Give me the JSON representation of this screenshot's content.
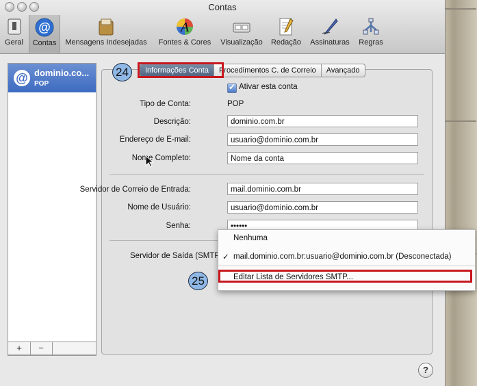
{
  "window": {
    "title": "Contas"
  },
  "toolbar": {
    "items": [
      {
        "label": "Geral",
        "icon": "switch-icon"
      },
      {
        "label": "Contas",
        "icon": "at-sign-icon"
      },
      {
        "label": "Mensagens Indesejadas",
        "icon": "junk-mail-icon"
      },
      {
        "label": "Fontes & Cores",
        "icon": "fonts-colors-icon"
      },
      {
        "label": "Visualização",
        "icon": "viewing-icon"
      },
      {
        "label": "Redação",
        "icon": "composing-icon"
      },
      {
        "label": "Assinaturas",
        "icon": "signature-pen-icon"
      },
      {
        "label": "Regras",
        "icon": "rules-icon"
      }
    ],
    "selected": "Contas"
  },
  "sidebar": {
    "account_name": "dominio.co...",
    "account_type": "POP",
    "add_label": "+",
    "remove_label": "−"
  },
  "tabs": {
    "info": "Informações Conta",
    "mailbox": "Procedimentos C. de Correio",
    "advanced": "Avançado",
    "selected": "Informações Conta"
  },
  "annotations": {
    "badge_24": "24",
    "badge_25": "25",
    "highlight_color": "#c8171d"
  },
  "form": {
    "enable_label": "Ativar esta conta",
    "enabled": true,
    "type_label": "Tipo de Conta:",
    "type_value": "POP",
    "description_label": "Descrição:",
    "description_value": "dominio.com.br",
    "email_label": "Endereço de E-mail:",
    "email_value": "usuario@dominio.com.br",
    "fullname_label": "Nome Completo:",
    "fullname_value": "Nome da conta",
    "incoming_label": "Servidor de Correio de Entrada:",
    "incoming_value": "mail.dominio.com.br",
    "username_label": "Nome de Usuário:",
    "username_value": "usuario@dominio.com.br",
    "password_label": "Senha:",
    "password_value": "••••••",
    "smtp_label": "Servidor de Saída (SMTP"
  },
  "smtp_menu": {
    "none": "Nenhuma",
    "checkmark": "✓",
    "server": "mail.dominio.com.br:usuario@dominio.com.br (Desconectada)",
    "edit": "Editar Lista de Servidores SMTP..."
  },
  "help": {
    "label": "?"
  }
}
